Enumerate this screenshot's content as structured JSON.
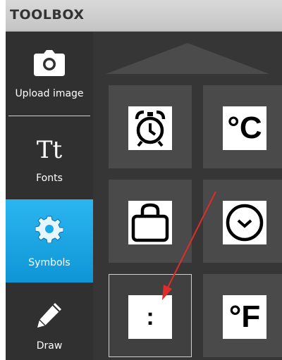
{
  "toolbox": {
    "title": "TOOLBOX"
  },
  "sidebar": {
    "items": [
      {
        "label": "Upload image",
        "icon": "camera-icon",
        "active": false
      },
      {
        "label": "Fonts",
        "icon": "tt-font-icon",
        "icon_text": "Tt",
        "active": false
      },
      {
        "label": "Symbols",
        "icon": "gear-icon",
        "active": true
      },
      {
        "label": "Draw",
        "icon": "pencil-icon",
        "active": false
      }
    ]
  },
  "symbols": {
    "scroll_up": "up-arrow-icon",
    "items": [
      {
        "name": "alarm-clock-icon",
        "text": ""
      },
      {
        "name": "celsius-icon",
        "text": "°C"
      },
      {
        "name": "bag-icon",
        "text": ""
      },
      {
        "name": "clock-icon",
        "text": ""
      },
      {
        "name": "colon-icon",
        "text": ":",
        "selected": true
      },
      {
        "name": "fahrenheit-icon",
        "text": "°F"
      }
    ]
  },
  "annotation": {
    "arrow_color": "#e32b2b"
  },
  "colors": {
    "active_accent": "#1ba8e6",
    "panel": "#303030"
  }
}
